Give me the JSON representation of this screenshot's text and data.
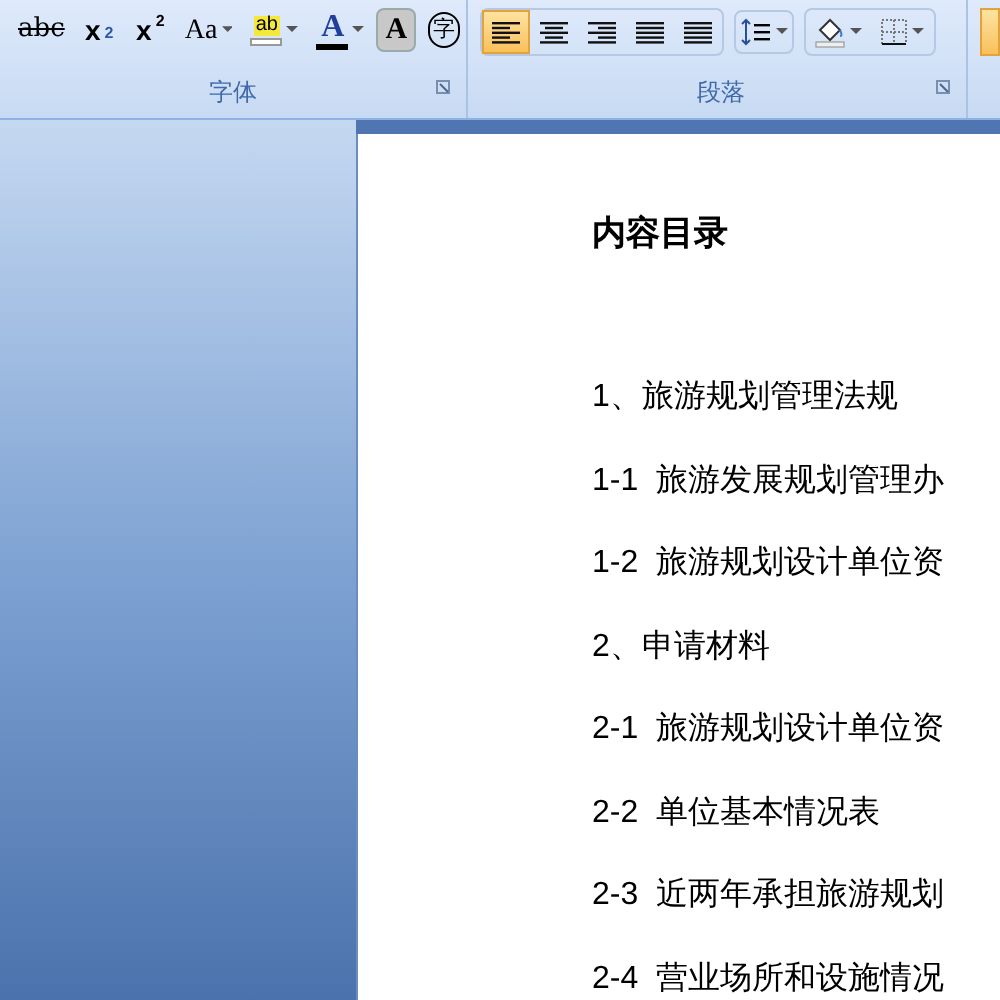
{
  "ribbon": {
    "font_group": {
      "label": "字体",
      "buttons": [
        {
          "kind": "strike",
          "text": "abc"
        },
        {
          "kind": "sub",
          "text": "x",
          "mark": "2"
        },
        {
          "kind": "sup",
          "text": "x",
          "mark": "2"
        },
        {
          "kind": "case",
          "text": "Aa"
        },
        {
          "kind": "highlight",
          "text": "ab"
        },
        {
          "kind": "color",
          "text": "A"
        },
        {
          "kind": "shade",
          "text": "A"
        },
        {
          "kind": "enclose",
          "text": "字"
        }
      ]
    },
    "paragraph_group": {
      "label": "段落",
      "align_buttons": [
        {
          "kind": "left",
          "selected": true
        },
        {
          "kind": "center",
          "selected": false
        },
        {
          "kind": "right",
          "selected": false
        },
        {
          "kind": "justify",
          "selected": false
        },
        {
          "kind": "distributed",
          "selected": false
        }
      ]
    }
  },
  "document": {
    "title": "内容目录",
    "lines": [
      "1、旅游规划管理法规",
      "1-1  旅游发展规划管理办",
      "1-2  旅游规划设计单位资",
      "2、申请材料",
      "2-1  旅游规划设计单位资",
      "2-2  单位基本情况表",
      "2-3  近两年承担旅游规划",
      "2-4  营业场所和设施情况"
    ]
  }
}
